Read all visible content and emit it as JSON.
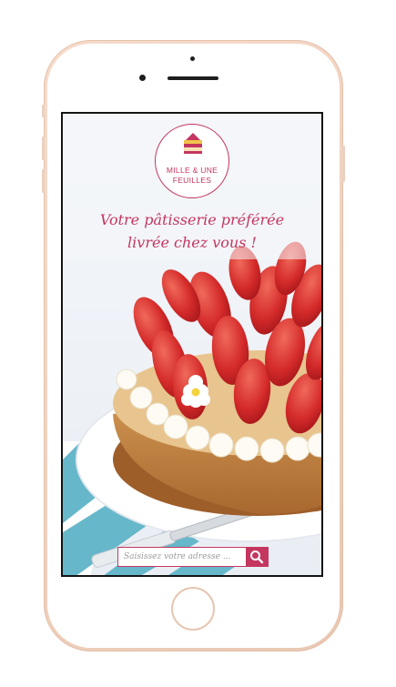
{
  "app": {
    "brand_name_line1": "MILLE & UNE",
    "brand_name_line2": "FEUILLES",
    "tagline_line1": "Votre pâtisserie préférée",
    "tagline_line2": "livrée chez vous !"
  },
  "search": {
    "placeholder": "Saisissez votre adresse ...",
    "value": ""
  },
  "icons": {
    "logo": "cake-slice-icon",
    "search": "magnifier-icon"
  },
  "colors": {
    "accent": "#c4365f",
    "phone_frame": "#f1d3c0"
  }
}
